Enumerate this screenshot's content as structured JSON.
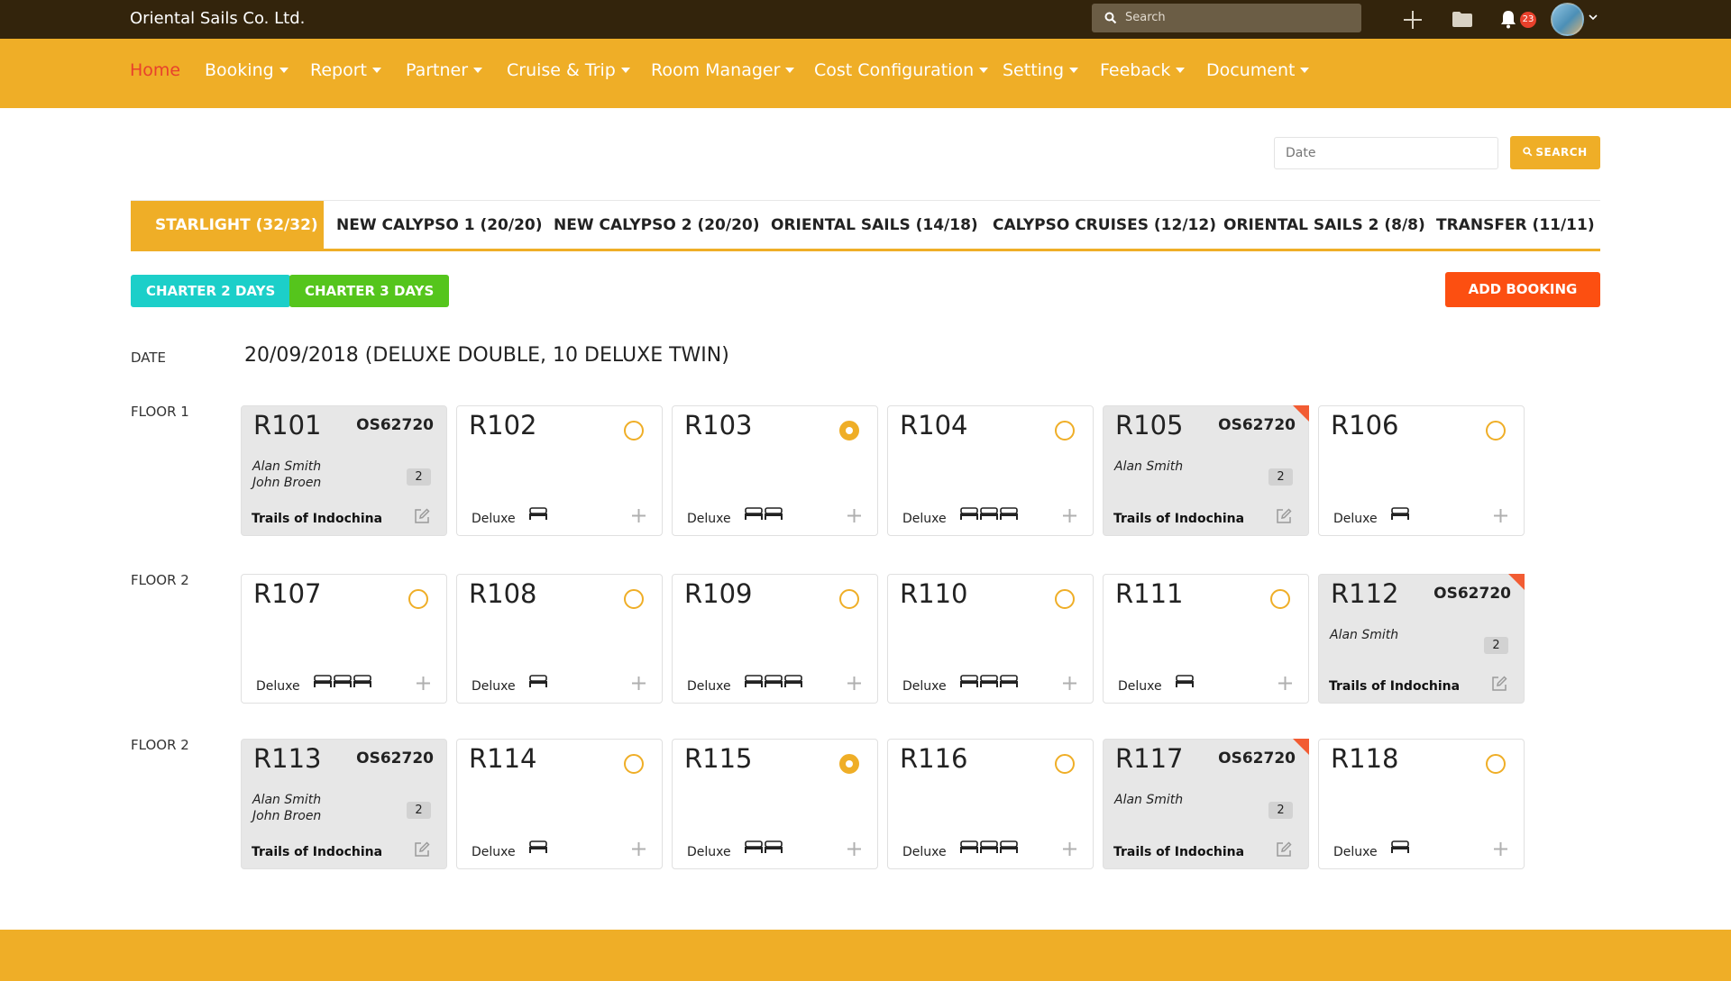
{
  "app": {
    "brand": "Oriental Sails Co. Ltd."
  },
  "topbar": {
    "search_placeholder": "Search",
    "notification_count": "23"
  },
  "nav": [
    "Home",
    "Booking",
    "Report",
    "Partner",
    "Cruise & Trip",
    "Room Manager",
    "Cost Configuration",
    "Setting",
    "Feeback",
    "Document"
  ],
  "search": {
    "date_placeholder": "Date",
    "button": "SEARCH"
  },
  "tabs": [
    "STARLIGHT (32/32)",
    "NEW CALYPSO 1 (20/20)",
    "NEW CALYPSO 2 (20/20)",
    "ORIENTAL SAILS (14/18)",
    "CALYPSO CRUISES (12/12)",
    "ORIENTAL SAILS 2 (8/8)",
    "TRANSFER (11/11)"
  ],
  "chips": [
    "CHARTER 2 DAYS",
    "CHARTER 3 DAYS"
  ],
  "add_booking": "ADD BOOKING",
  "date_label": "DATE",
  "date_value": "20/09/2018 (DELUXE DOUBLE, 10 DELUXE TWIN)",
  "floors": [
    {
      "label": "FLOOR 1",
      "rooms": [
        {
          "number": "R101",
          "booked": true,
          "code": "OS62720",
          "guests": [
            "Alan Smith",
            "John Broen"
          ],
          "count": "2",
          "company": "Trails of Indochina",
          "flag": false
        },
        {
          "number": "R102",
          "booked": false,
          "selected": false,
          "type": "Deluxe",
          "beds": 1
        },
        {
          "number": "R103",
          "booked": false,
          "selected": true,
          "type": "Deluxe",
          "beds": 2
        },
        {
          "number": "R104",
          "booked": false,
          "selected": false,
          "type": "Deluxe",
          "beds": 3
        },
        {
          "number": "R105",
          "booked": true,
          "code": "OS62720",
          "guests": [
            "Alan Smith"
          ],
          "count": "2",
          "company": "Trails of Indochina",
          "flag": true
        },
        {
          "number": "R106",
          "booked": false,
          "selected": false,
          "type": "Deluxe",
          "beds": 1
        }
      ]
    },
    {
      "label": "FLOOR 2",
      "rooms": [
        {
          "number": "R107",
          "booked": false,
          "selected": false,
          "type": "Deluxe",
          "beds": 3
        },
        {
          "number": "R108",
          "booked": false,
          "selected": false,
          "type": "Deluxe",
          "beds": 1
        },
        {
          "number": "R109",
          "booked": false,
          "selected": false,
          "type": "Deluxe",
          "beds": 3
        },
        {
          "number": "R110",
          "booked": false,
          "selected": false,
          "type": "Deluxe",
          "beds": 3
        },
        {
          "number": "R111",
          "booked": false,
          "selected": false,
          "type": "Deluxe",
          "beds": 1
        },
        {
          "number": "R112",
          "booked": true,
          "code": "OS62720",
          "guests": [
            "Alan Smith"
          ],
          "count": "2",
          "company": "Trails of Indochina",
          "flag": true
        }
      ]
    },
    {
      "label": "FLOOR 2",
      "rooms": [
        {
          "number": "R113",
          "booked": true,
          "code": "OS62720",
          "guests": [
            "Alan Smith",
            "John Broen"
          ],
          "count": "2",
          "company": "Trails of Indochina",
          "flag": false
        },
        {
          "number": "R114",
          "booked": false,
          "selected": false,
          "type": "Deluxe",
          "beds": 1
        },
        {
          "number": "R115",
          "booked": false,
          "selected": true,
          "type": "Deluxe",
          "beds": 2
        },
        {
          "number": "R116",
          "booked": false,
          "selected": false,
          "type": "Deluxe",
          "beds": 3
        },
        {
          "number": "R117",
          "booked": true,
          "code": "OS62720",
          "guests": [
            "Alan Smith"
          ],
          "count": "2",
          "company": "Trails of Indochina",
          "flag": true
        },
        {
          "number": "R118",
          "booked": false,
          "selected": false,
          "type": "Deluxe",
          "beds": 1
        }
      ]
    }
  ],
  "colors": {
    "primary": "#efae27",
    "topbar": "#33240c",
    "active_nav": "#e8412c",
    "add_booking": "#fc4f11",
    "chip_teal": "#1ccfc9",
    "chip_green": "#55c51c",
    "flag": "#f25c33"
  },
  "icons": {
    "search": "search-icon",
    "plus": "plus-icon",
    "folder": "folder-icon",
    "bell": "bell-icon",
    "edit": "edit-icon",
    "bed": "bed-icon",
    "radio": "radio-icon"
  }
}
